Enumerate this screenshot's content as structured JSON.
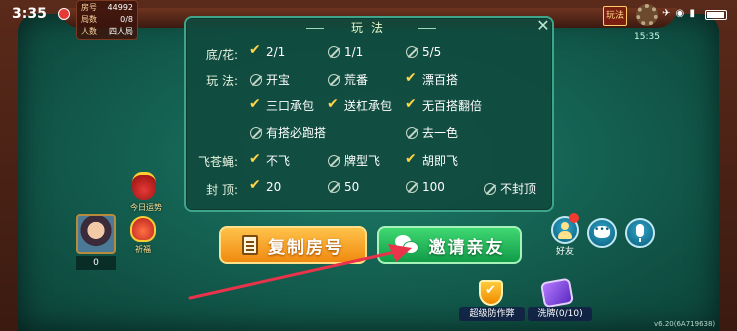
{
  "status_bar": {
    "time": "3:35",
    "sys_icons": "✈ ◉ ▮"
  },
  "room": {
    "room_label": "房号",
    "room_number": "44992",
    "rounds_label": "局数",
    "rounds_value": "0/8",
    "players_label": "人数",
    "players_value": "四人局"
  },
  "top_right": {
    "rules_label": "玩法",
    "clock": "15:35"
  },
  "panel": {
    "title": "玩法",
    "rows": [
      {
        "label": "底/花:",
        "options": [
          {
            "text": "2/1",
            "checked": true
          },
          {
            "text": "1/1",
            "checked": false
          },
          {
            "text": "5/5",
            "checked": false
          }
        ]
      },
      {
        "label": "玩 法:",
        "options": [
          {
            "text": "开宝",
            "checked": false
          },
          {
            "text": "荒番",
            "checked": false
          },
          {
            "text": "漂百搭",
            "checked": true
          }
        ]
      },
      {
        "label": "",
        "options": [
          {
            "text": "三口承包",
            "checked": true
          },
          {
            "text": "送杠承包",
            "checked": true
          },
          {
            "text": "无百搭翻倍",
            "checked": true
          }
        ]
      },
      {
        "label": "",
        "options": [
          {
            "text": "有搭必跑搭",
            "checked": false
          },
          {
            "text": "去一色",
            "checked": false
          }
        ]
      },
      {
        "label": "飞苍蝇:",
        "options": [
          {
            "text": "不飞",
            "checked": true
          },
          {
            "text": "牌型飞",
            "checked": false
          },
          {
            "text": "胡即飞",
            "checked": true
          }
        ]
      },
      {
        "label": "封 顶:",
        "options": [
          {
            "text": "20",
            "checked": true
          },
          {
            "text": "50",
            "checked": false
          },
          {
            "text": "100",
            "checked": false
          },
          {
            "text": "不封顶",
            "checked": false
          }
        ]
      }
    ]
  },
  "left": {
    "fortune_label": "今日运势",
    "blessing_label": "祈福",
    "avatar_score": "0"
  },
  "buttons": {
    "copy_room": "复制房号",
    "invite": "邀请亲友",
    "friend": "好友",
    "chat_glyph": "•••",
    "anti_cheat": "超级防作弊",
    "shuffle": "洗牌(0/10)"
  },
  "version": "v6.20(6A719638)",
  "colors": {
    "felt": "#146152",
    "check": "#ffd54a",
    "copy_button": "#f08a10",
    "invite_button": "#119b48",
    "arrow": "#e8334a"
  }
}
